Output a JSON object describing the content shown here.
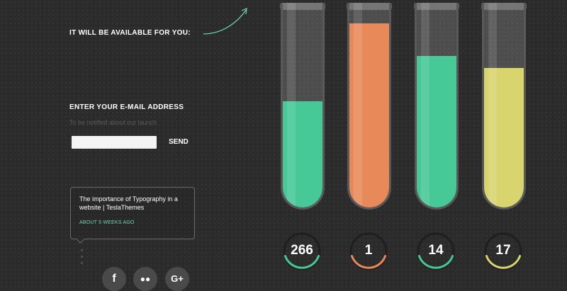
{
  "signup": {
    "available_heading": "IT WILL BE AVAILABLE FOR YOU:",
    "email_heading": "ENTER YOUR E-MAIL ADDRESS",
    "email_subtext": "To be notified about our launch",
    "email_value": "",
    "send_label": "SEND"
  },
  "tweet": {
    "text": "The importance of Typography in a website | TeslaThemes",
    "time": "ABOUT 5 WEEKS AGO"
  },
  "social": [
    {
      "name": "facebook",
      "glyph": "f"
    },
    {
      "name": "flickr",
      "glyph": "●●"
    },
    {
      "name": "google-plus",
      "glyph": "G+"
    }
  ],
  "counters": [
    {
      "value": "266",
      "fill_level": 0.52,
      "color": "#46c897"
    },
    {
      "value": "1",
      "fill_level": 0.9,
      "color": "#e8895a"
    },
    {
      "value": "14",
      "fill_level": 0.74,
      "color": "#46c897"
    },
    {
      "value": "17",
      "fill_level": 0.68,
      "color": "#d8d46e"
    }
  ],
  "colors": {
    "background": "#2b2b2b",
    "accent_green": "#6fd8ae"
  }
}
